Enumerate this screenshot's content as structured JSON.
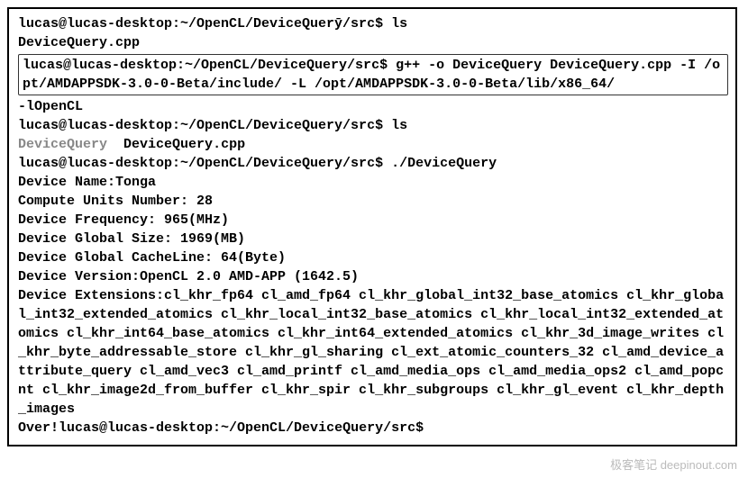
{
  "prompt_base": "lucas@lucas-desktop:~/OpenCL/DeviceQuery/src$",
  "prompt_arrow": "lucas@lucas-desktop:~/OpenCL/DeviceQuerȳ/src$",
  "cmd_ls1": " ls",
  "file_cpp": "DeviceQuery.cpp",
  "compile_cmd_part1": " g++ -o DeviceQuery DeviceQuery.cpp -I /opt/AMDAPPSDK-3.0-0-Beta/include/ -L /opt/AMDAPPSDK-3.0-0-Beta/lib/x86_64/",
  "compile_tail": "-lOpenCL",
  "cmd_ls2": " ls",
  "file_exe": "DeviceQuery",
  "files_sep": "  ",
  "file_cpp2": "DeviceQuery.cpp",
  "cmd_run": " ./DeviceQuery",
  "out_name": "Device Name:Tonga",
  "out_units": "Compute Units Number: 28",
  "out_freq": "Device Frequency: 965(MHz)",
  "out_global": "Device Global Size: 1969(MB)",
  "out_cacheline": "Device Global CacheLine: 64(Byte)",
  "out_version": "Device Version:OpenCL 2.0 AMD-APP (1642.5)",
  "out_ext": "Device Extensions:cl_khr_fp64 cl_amd_fp64 cl_khr_global_int32_base_atomics cl_khr_global_int32_extended_atomics cl_khr_local_int32_base_atomics cl_khr_local_int32_extended_atomics cl_khr_int64_base_atomics cl_khr_int64_extended_atomics cl_khr_3d_image_writes cl_khr_byte_addressable_store cl_khr_gl_sharing cl_ext_atomic_counters_32 cl_amd_device_attribute_query cl_amd_vec3 cl_amd_printf cl_amd_media_ops cl_amd_media_ops2 cl_amd_popcnt cl_khr_image2d_from_buffer cl_khr_spir cl_khr_subgroups cl_khr_gl_event cl_khr_depth_images",
  "out_over": "Over!",
  "watermark": "极客笔记 deepinout.com"
}
